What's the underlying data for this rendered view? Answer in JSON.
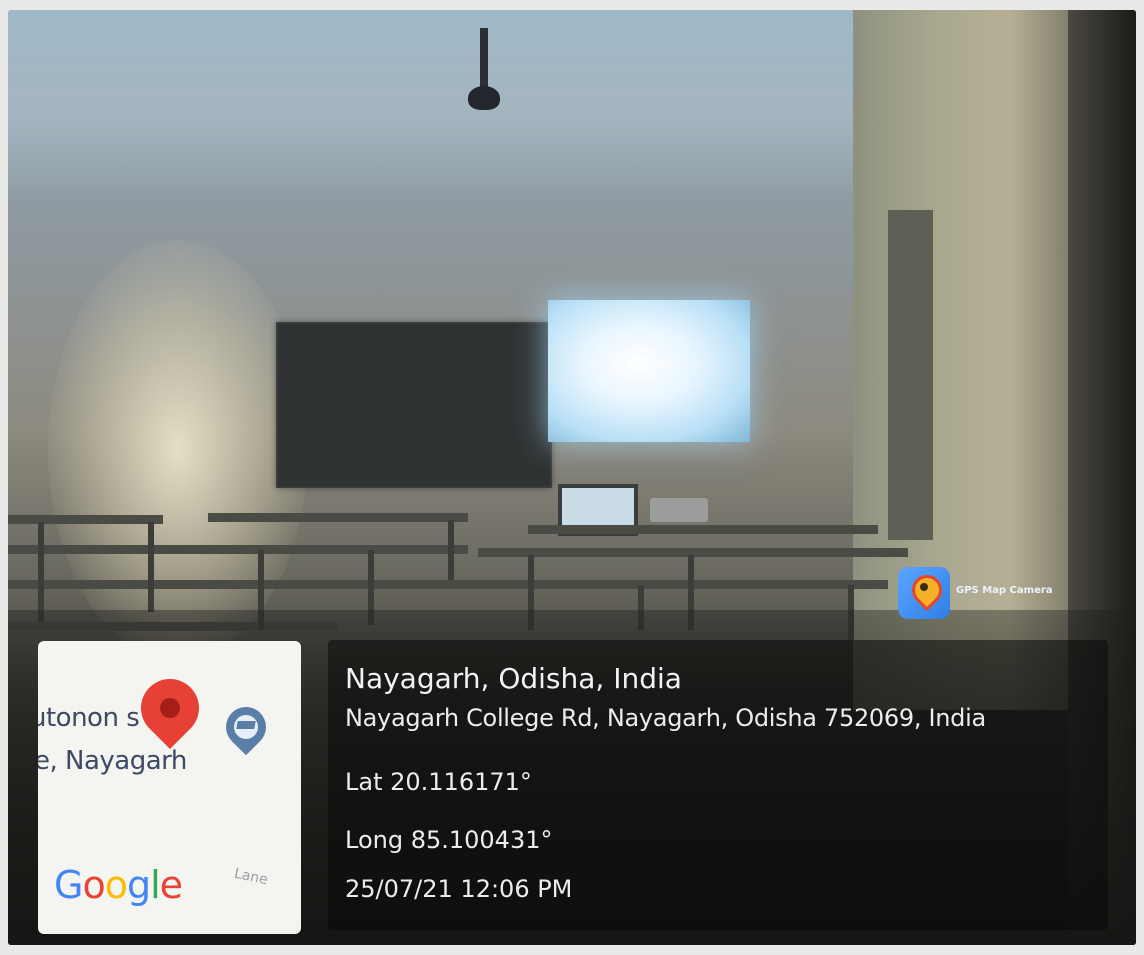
{
  "image": {
    "badge": {
      "icon": "gps-map-camera-icon",
      "label": "GPS Map Camera"
    },
    "location": {
      "title": "Nayagarh, Odisha, India",
      "address": "Nayagarh College Rd, Nayagarh, Odisha 752069, India",
      "latitude": "Lat 20.116171°",
      "longitude": "Long 85.100431°",
      "datetime": "25/07/21 12:06 PM"
    },
    "map": {
      "label_line1": "utonon   s",
      "label_line2": "e, Nayagarh",
      "road_label": "Lane",
      "logo": "Google",
      "pins": [
        "red-location-pin-icon",
        "education-pin-icon"
      ]
    }
  }
}
